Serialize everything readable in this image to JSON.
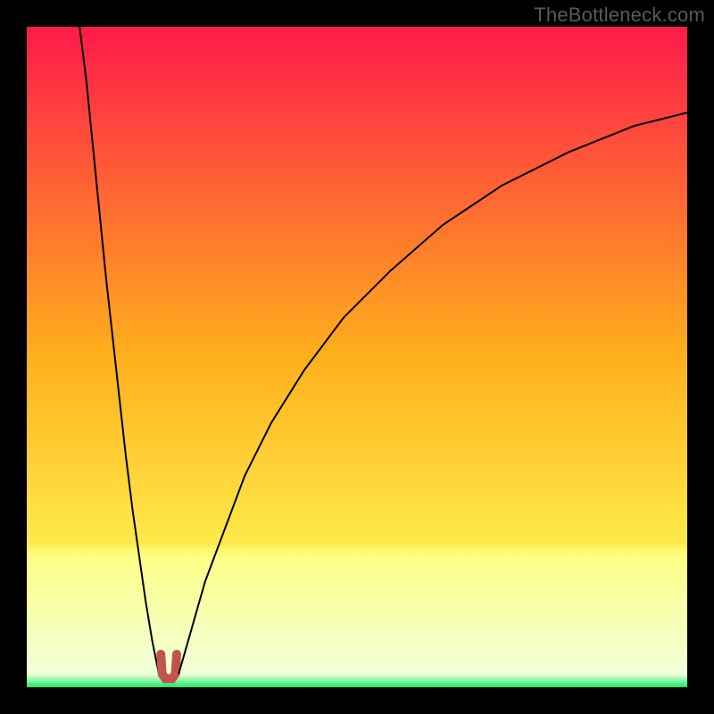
{
  "watermark": "TheBottleneck.com",
  "chart_data": {
    "type": "line",
    "title": "",
    "xlabel": "",
    "ylabel": "",
    "xlim": [
      0,
      100
    ],
    "ylim": [
      0,
      100
    ],
    "grid": false,
    "legend": false,
    "background_gradient": {
      "stops": [
        {
          "pos": 0.0,
          "color": "#ff1a4b"
        },
        {
          "pos": 0.5,
          "color": "#ffb01c"
        },
        {
          "pos": 0.78,
          "color": "#ffe94a"
        },
        {
          "pos": 0.8,
          "color": "#fdff84"
        },
        {
          "pos": 0.98,
          "color": "#f2ffda"
        },
        {
          "pos": 1.0,
          "color": "#18e966"
        }
      ]
    },
    "series": [
      {
        "name": "curve-left",
        "stroke": "#000000",
        "stroke_width": 2,
        "x": [
          8.0,
          9.0,
          10.0,
          11.0,
          12.0,
          13.0,
          14.0,
          15.0,
          16.0,
          17.0,
          18.0,
          19.0,
          20.0
        ],
        "y": [
          100.0,
          92.0,
          82.0,
          72.0,
          62.0,
          53.0,
          44.0,
          35.0,
          27.0,
          20.0,
          13.0,
          7.0,
          2.0
        ]
      },
      {
        "name": "valley-marker",
        "stroke": "#c1554c",
        "stroke_width": 10,
        "linecap": "round",
        "x": [
          20.3,
          20.5,
          21.0,
          21.5,
          22.0,
          22.5,
          22.7
        ],
        "y": [
          5.0,
          2,
          1.3,
          1.3,
          1.3,
          2,
          5.0
        ]
      },
      {
        "name": "curve-right",
        "stroke": "#000000",
        "stroke_width": 2,
        "x": [
          23.0,
          25.0,
          27.0,
          30.0,
          33.0,
          37.0,
          42.0,
          48.0,
          55.0,
          63.0,
          72.0,
          82.0,
          92.0,
          100.0
        ],
        "y": [
          2.0,
          9.0,
          16.0,
          24.0,
          32.0,
          40.0,
          48.0,
          56.0,
          63.0,
          70.0,
          76.0,
          81.0,
          85.0,
          87.0
        ]
      }
    ]
  }
}
